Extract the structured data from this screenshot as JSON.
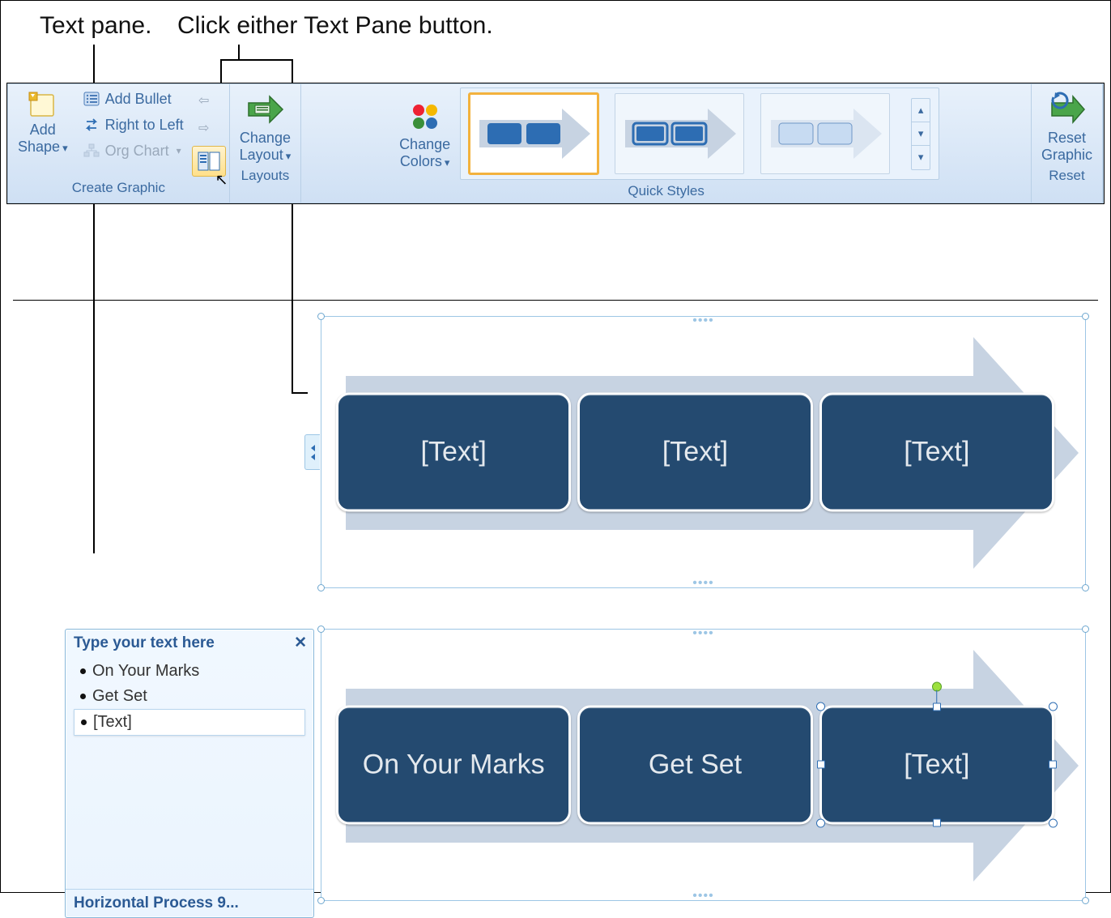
{
  "callouts": {
    "text_pane": "Text pane.",
    "click_either": "Click either Text Pane button."
  },
  "ribbon": {
    "groups": {
      "create_graphic": {
        "label": "Create Graphic",
        "add_shape": "Add\nShape",
        "add_bullet": "Add Bullet",
        "right_to_left": "Right to Left",
        "org_chart": "Org Chart"
      },
      "layouts": {
        "label": "Layouts",
        "change_layout": "Change\nLayout"
      },
      "quick_styles": {
        "label": "Quick Styles",
        "change_colors": "Change\nColors"
      },
      "reset": {
        "label": "Reset",
        "reset_graphic": "Reset\nGraphic"
      }
    }
  },
  "smartart1": {
    "box1": "[Text]",
    "box2": "[Text]",
    "box3": "[Text]"
  },
  "smartart2": {
    "box1": "On Your Marks",
    "box2": "Get Set",
    "box3": "[Text]"
  },
  "textpane": {
    "title": "Type your text here",
    "items": [
      "On Your Marks",
      "Get Set",
      "[Text]"
    ],
    "footer": "Horizontal Process 9..."
  }
}
